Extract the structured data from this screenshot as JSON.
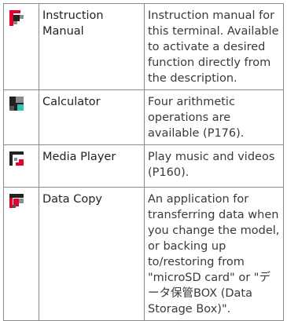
{
  "colors": {
    "border": "#8a8a8a",
    "text": "#231f20",
    "icon_red": "#e4002b",
    "icon_dark": "#222222",
    "icon_gray": "#8c8c8c",
    "icon_teal": "#2fc5b4"
  },
  "rows": [
    {
      "icon": "instruction-manual-icon",
      "name": "Instruction Manual",
      "description": "Instruction manual for this terminal. Available to activate a desired function directly from the description."
    },
    {
      "icon": "calculator-icon",
      "name": "Calculator",
      "description": "Four arithmetic operations are available (P176)."
    },
    {
      "icon": "media-player-icon",
      "name": "Media Player",
      "description": "Play music and videos (P160)."
    },
    {
      "icon": "data-copy-icon",
      "name": "Data Copy",
      "description": "An application for transferring data when you change the model, or backing up to/restoring from \"microSD card\" or \"データ保管BOX (Data Storage Box)\"."
    }
  ]
}
